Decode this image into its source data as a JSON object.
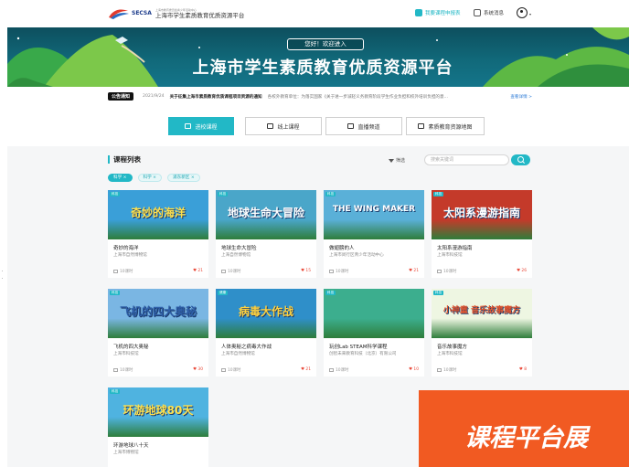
{
  "header": {
    "logo_sub": "上海市教育委员会青少年活动中心",
    "logo_text": "上海市学生素质教育优质资源平台",
    "logo_abbr": "SECSA",
    "report_link": "我要课程申报表",
    "messages_link": "系统消息"
  },
  "banner": {
    "welcome": "您好！欢迎进入",
    "title": "上海市学生素质教育优质资源平台"
  },
  "notice": {
    "tag": "公告通知",
    "date": "2021/9/24",
    "title": "关于征集上海市素质教育优质课程项目资源的通知",
    "body": "各校外教育单位：为落实国家《关于进一步减轻义务教育阶段学生作业负担和校外培训负担的意...",
    "more": "查看详情 >"
  },
  "tabs": [
    {
      "label": "进校课程",
      "active": true
    },
    {
      "label": "线上课程",
      "active": false
    },
    {
      "label": "直播频道",
      "active": false
    },
    {
      "label": "素质教育资源地图",
      "active": false
    }
  ],
  "list": {
    "title": "课程列表",
    "filter": "筛选",
    "search_placeholder": "搜索关键词",
    "chips": [
      "科学 ×",
      "科学 ×",
      "浦东新区 ×"
    ]
  },
  "courses": [
    {
      "badge": "科技",
      "title": "奇妙的海洋",
      "org": "上海市自然博物馆",
      "lessons": "10课时",
      "likes": "21",
      "art": "奇妙的海洋",
      "bg": "#3a9fd8",
      "fg": "#ffe14d"
    },
    {
      "badge": "科技",
      "title": "地球生命大冒险",
      "org": "上海自然博物馆",
      "lessons": "10课时",
      "likes": "15",
      "art": "地球生命大冒险",
      "bg": "#4aa6c9",
      "fg": "#ffffff"
    },
    {
      "badge": "科技",
      "title": "做翅膀的人",
      "org": "上海市闵行区青少年活动中心",
      "lessons": "10课时",
      "likes": "21",
      "art": "THE WING MAKER",
      "bg": "#5ab0d8",
      "fg": "#ffffff"
    },
    {
      "badge": "科技",
      "title": "太阳系漫游指南",
      "org": "上海市科技馆",
      "lessons": "10课时",
      "likes": "26",
      "art": "太阳系漫游指南",
      "bg": "#c43a2a",
      "fg": "#ffffff"
    },
    {
      "badge": "科技",
      "title": "飞机的四大奥秘",
      "org": "上海市科技馆",
      "lessons": "10课时",
      "likes": "30",
      "art": "飞机的四大奥秘",
      "bg": "#7ab6e3",
      "fg": "#2f5fa8"
    },
    {
      "badge": "健康",
      "title": "人体奥秘之病毒大作战",
      "org": "上海市自然博物馆",
      "lessons": "10课时",
      "likes": "21",
      "art": "病毒大作战",
      "bg": "#2f8fc9",
      "fg": "#ffd23f"
    },
    {
      "badge": "科技",
      "title": "玩创Lab STEAM科学课程",
      "org": "创智未来教育科技（北京）有限公司",
      "lessons": "10课时",
      "likes": "10",
      "art": "",
      "bg": "#3cae8e",
      "fg": "#ffffff"
    },
    {
      "badge": "科技",
      "title": "音乐故事魔方",
      "org": "上海市科技馆",
      "lessons": "10课时",
      "likes": "8",
      "art": "小神童 音乐故事魔方",
      "bg": "#eef6e2",
      "fg": "#e0512b"
    },
    {
      "badge": "科技",
      "title": "环游地球八十天",
      "org": "上海市博物馆",
      "lessons": "",
      "likes": "",
      "art": "环游地球80天",
      "bg": "#4fb3e0",
      "fg": "#ffe14d"
    }
  ],
  "promo": {
    "text": "课程平台展"
  },
  "colors": {
    "accent": "#22b8c6",
    "banner": "#11697a",
    "like": "#e94a3a",
    "promo": "#f15a22"
  }
}
